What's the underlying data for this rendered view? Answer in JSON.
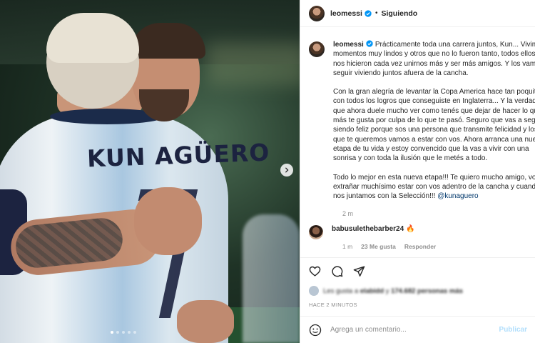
{
  "post": {
    "author": "leomessi",
    "follow_status": "Siguiendo",
    "jersey_text": "KUN AGÜERO",
    "caption_paragraphs": [
      [
        "Prácticamente toda una carrera juntos, Kun... Vivimos",
        "momentos muy lindos y otros que no lo fueron tanto, todos ellos",
        "nos hicieron cada vez unirnos más y ser más amigos. Y los vamos a",
        "seguir viviendo juntos afuera de la cancha."
      ],
      [
        "Con la gran alegría de levantar la Copa America hace tan poquito",
        "con todos los logros que conseguiste en Inglaterra... Y la verdad es",
        "que ahora duele mucho ver como tenés que dejar de hacer lo que",
        "más te gusta por culpa de lo que te pasó. Seguro que vas a seguir",
        "siendo feliz porque sos una persona que transmite felicidad y los",
        "que te queremos vamos a estar con vos. Ahora arranca una nueva",
        "etapa de tu vida y estoy convencido que la vas a vivir con una",
        "sonrisa y con toda la ilusión que le metés a todo."
      ],
      [
        "Todo lo mejor en esta nueva etapa!!! Te quiero mucho amigo, voy a",
        "extrañar muchísimo estar con vos adentro de la cancha y cuando",
        "nos juntamos con la Selección!!! "
      ]
    ],
    "mention": "@kunaguero",
    "caption_time": "2 m"
  },
  "comment": {
    "username": "babusulethebarber24",
    "emoji": "🔥",
    "time": "1 m",
    "likes": "23 Me gusta",
    "reply": "Responder"
  },
  "likes_line": {
    "prefix": "Les gusta a",
    "user": "elabidd",
    "middle": "y",
    "count": "174.682",
    "suffix": "personas más"
  },
  "posted_ago": "HACE 2 MINUTOS",
  "add_comment": {
    "placeholder": "Agrega un comentario...",
    "publish": "Publicar"
  },
  "carousel": {
    "dots": 5,
    "active_index": 0
  },
  "colors": {
    "verified": "#0095f6",
    "link": "#00376b",
    "muted": "#8e8e8e"
  }
}
